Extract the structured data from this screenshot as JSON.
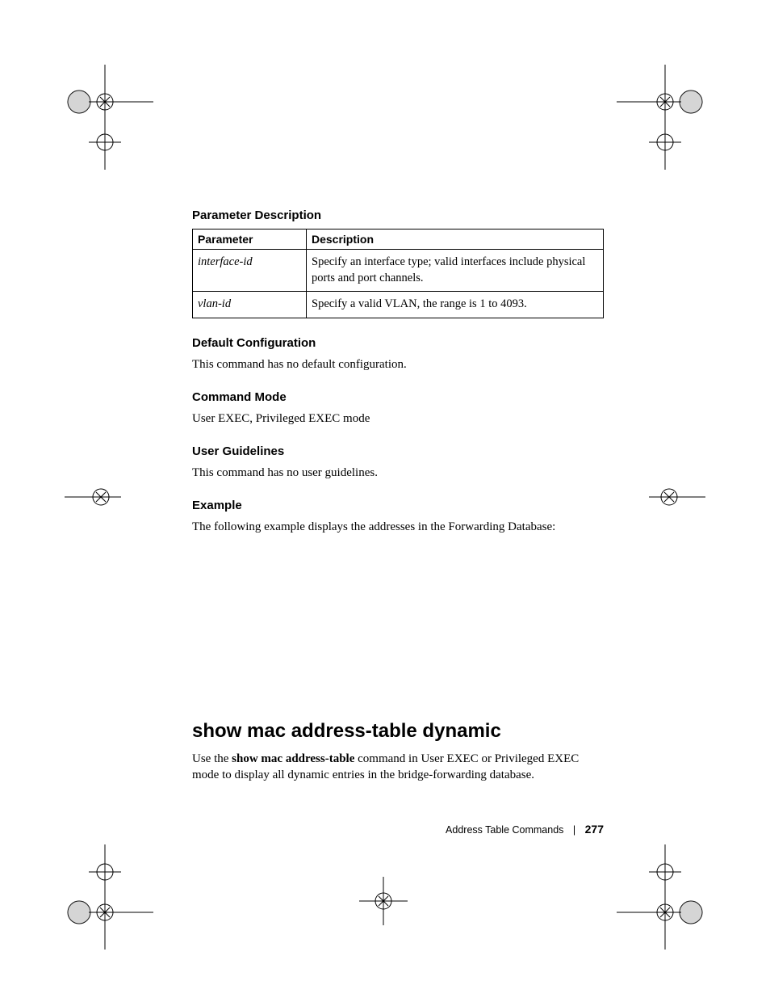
{
  "sections": {
    "param_desc_heading": "Parameter Description",
    "table": {
      "headers": {
        "param": "Parameter",
        "desc": "Description"
      },
      "rows": [
        {
          "param": "interface-id",
          "desc": "Specify an interface type; valid interfaces include physical ports and port channels."
        },
        {
          "param": "vlan-id",
          "desc": "Specify a valid VLAN, the range is 1 to 4093."
        }
      ]
    },
    "default_cfg_heading": "Default Configuration",
    "default_cfg_body": "This command has no default configuration.",
    "cmd_mode_heading": "Command Mode",
    "cmd_mode_body": "User EXEC, Privileged EXEC mode",
    "guidelines_heading": "User Guidelines",
    "guidelines_body": "This command has no user guidelines.",
    "example_heading": "Example",
    "example_body": "The following example displays the addresses in the Forwarding Database:"
  },
  "command": {
    "title": "show mac address-table dynamic",
    "intro_pre": "Use the ",
    "intro_bold": "show mac address-table",
    "intro_post": " command in User EXEC or Privileged EXEC mode to display all dynamic entries in the bridge-forwarding database."
  },
  "footer": {
    "chapter": "Address Table Commands",
    "page": "277"
  }
}
